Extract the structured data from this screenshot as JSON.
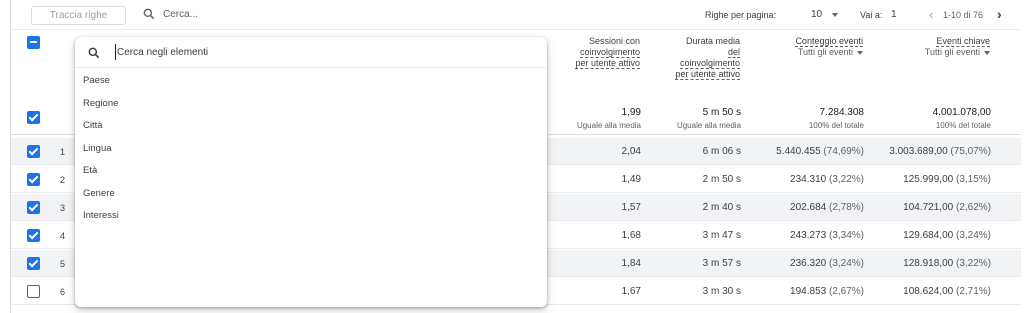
{
  "toolbar": {
    "track_rows_label": "Traccia righe",
    "search_placeholder": "Cerca...",
    "rows_per_page_label": "Righe per pagina:",
    "rows_per_page_value": "10",
    "goto_label": "Vai a:",
    "goto_value": "1",
    "page_range": "1-10 di 76"
  },
  "columns": [
    {
      "title_lines": [
        "Sessioni con",
        "coinvolgimento",
        "per utente attivo"
      ],
      "subtitle": ""
    },
    {
      "title_lines": [
        "Durata media",
        "del",
        "coinvolgimento",
        "per utente attivo"
      ],
      "subtitle": ""
    },
    {
      "title_lines": [
        "Conteggio eventi"
      ],
      "subtitle": "Tutti gli eventi"
    },
    {
      "title_lines": [
        "Eventi chiave"
      ],
      "subtitle": "Tutti gli eventi"
    }
  ],
  "totals": [
    {
      "value": "1,99",
      "sub": "Uguale alla media"
    },
    {
      "value": "5 m 50 s",
      "sub": "Uguale alla media"
    },
    {
      "value": "7.284.308",
      "sub": "100% del totale"
    },
    {
      "value": "4.001.078,00",
      "sub": "100% del totale"
    }
  ],
  "rows": [
    {
      "index": "1",
      "checked": true,
      "shaded": true,
      "sessions": "2,04",
      "duration": "6 m 06 s",
      "events": "5.440.455",
      "events_pct": "(74,69%)",
      "key_events": "3.003.689,00",
      "key_pct": "(75,07%)"
    },
    {
      "index": "2",
      "checked": true,
      "shaded": false,
      "sessions": "1,49",
      "duration": "2 m 50 s",
      "events": "234.310",
      "events_pct": "(3,22%)",
      "key_events": "125.999,00",
      "key_pct": "(3,15%)"
    },
    {
      "index": "3",
      "checked": true,
      "shaded": true,
      "sessions": "1,57",
      "duration": "2 m 40 s",
      "events": "202.684",
      "events_pct": "(2,78%)",
      "key_events": "104.721,00",
      "key_pct": "(2,62%)"
    },
    {
      "index": "4",
      "checked": true,
      "shaded": false,
      "sessions": "1,68",
      "duration": "3 m 47 s",
      "events": "243.273",
      "events_pct": "(3,34%)",
      "key_events": "129.684,00",
      "key_pct": "(3,24%)"
    },
    {
      "index": "5",
      "checked": true,
      "shaded": true,
      "sessions": "1,84",
      "duration": "3 m 57 s",
      "events": "236.320",
      "events_pct": "(3,24%)",
      "key_events": "128.918,00",
      "key_pct": "(3,22%)"
    },
    {
      "index": "6",
      "checked": false,
      "shaded": false,
      "sessions": "1,67",
      "duration": "3 m 30 s",
      "events": "194.853",
      "events_pct": "(2,67%)",
      "key_events": "108.624,00",
      "key_pct": "(2,71%)"
    }
  ],
  "popup": {
    "search_placeholder": "Cerca negli elementi",
    "items": [
      "Paese",
      "Regione",
      "Città",
      "Lingua",
      "Età",
      "Genere",
      "Interessi"
    ]
  },
  "colors": {
    "accent": "#1a73e8",
    "row_shade": "#f1f3f4"
  },
  "icons": {
    "search": "search-icon",
    "prev": "chevron-left-icon",
    "next": "chevron-right-icon",
    "dropdown": "caret-down-icon"
  }
}
